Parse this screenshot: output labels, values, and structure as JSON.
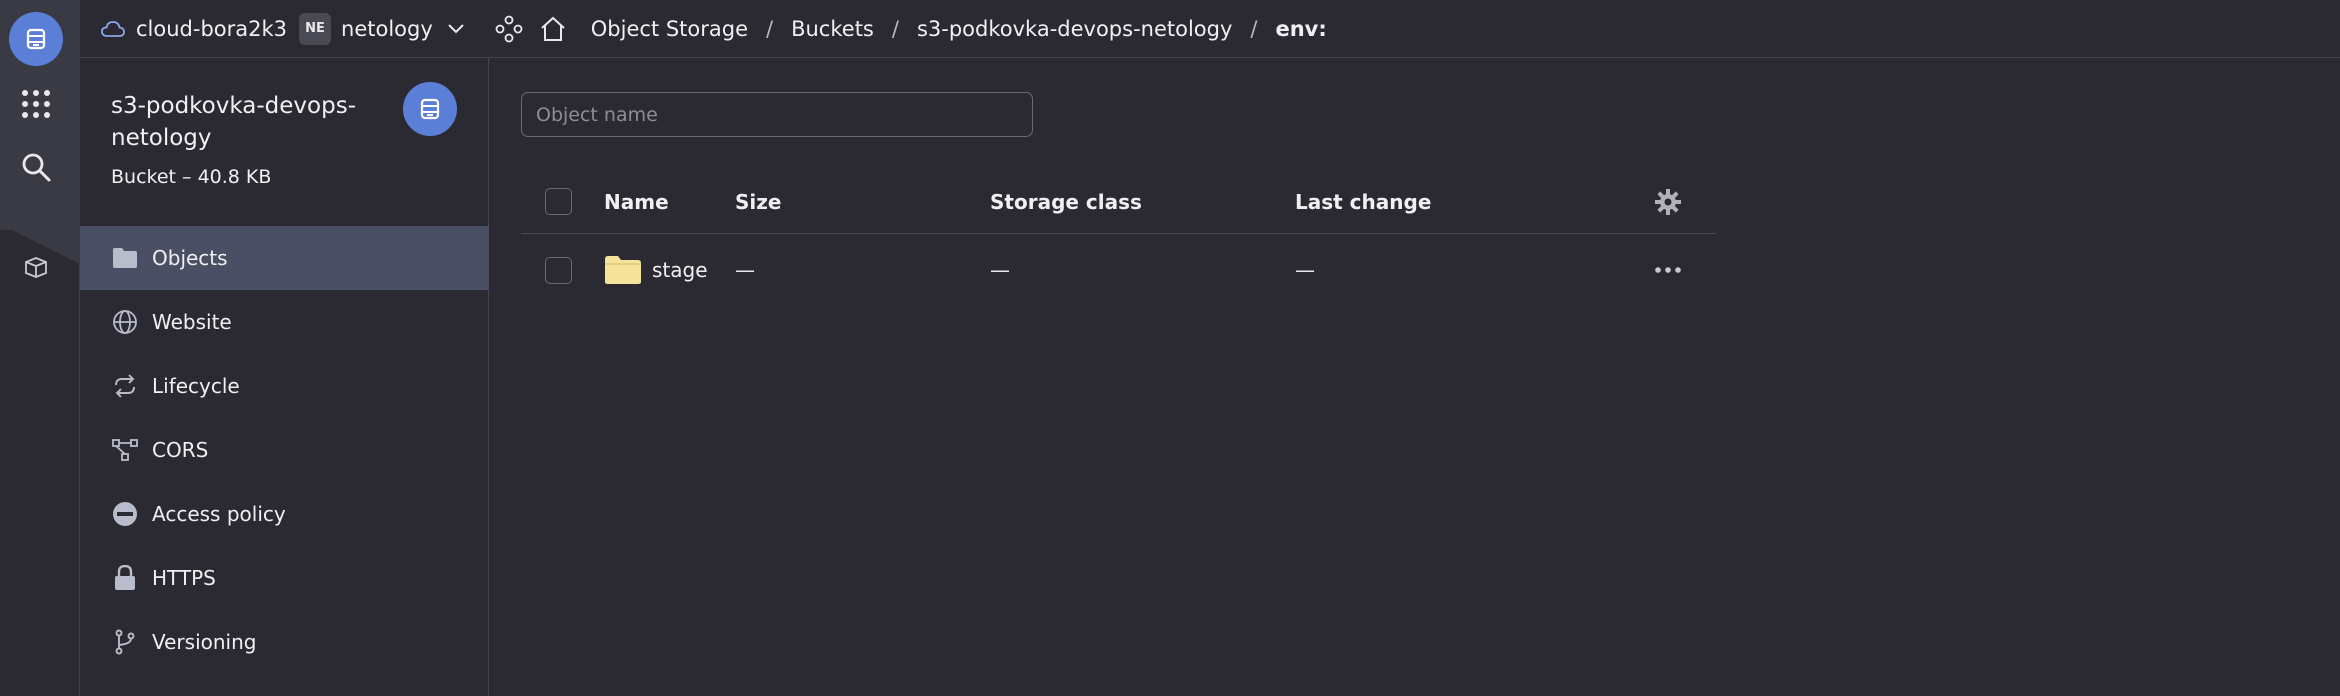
{
  "topbar": {
    "cloud_name": "cloud-bora2k3",
    "folder_badge": "NE",
    "folder_name": "netology",
    "breadcrumbs": [
      "Object Storage",
      "Buckets",
      "s3-podkovka-devops-netology",
      "env:"
    ]
  },
  "bucket": {
    "name": "s3-podkovka-devops-netology",
    "subtitle": "Bucket – 40.8 KB"
  },
  "sidebar": {
    "items": [
      {
        "label": "Objects",
        "icon": "folder-icon",
        "active": true
      },
      {
        "label": "Website",
        "icon": "globe-icon"
      },
      {
        "label": "Lifecycle",
        "icon": "cycle-icon"
      },
      {
        "label": "CORS",
        "icon": "cors-icon"
      },
      {
        "label": "Access policy",
        "icon": "no-entry-icon"
      },
      {
        "label": "HTTPS",
        "icon": "lock-icon"
      },
      {
        "label": "Versioning",
        "icon": "branch-icon"
      }
    ]
  },
  "search": {
    "placeholder": "Object name"
  },
  "table": {
    "columns": [
      "Name",
      "Size",
      "Storage class",
      "Last change"
    ],
    "rows": [
      {
        "name": "stage",
        "size": "—",
        "storage_class": "—",
        "last_change": "—"
      }
    ]
  },
  "colors": {
    "accent": "#5b7fd6",
    "background": "#2b2a33",
    "active_nav": "#4a4f64",
    "folder": "#f5e39a"
  }
}
